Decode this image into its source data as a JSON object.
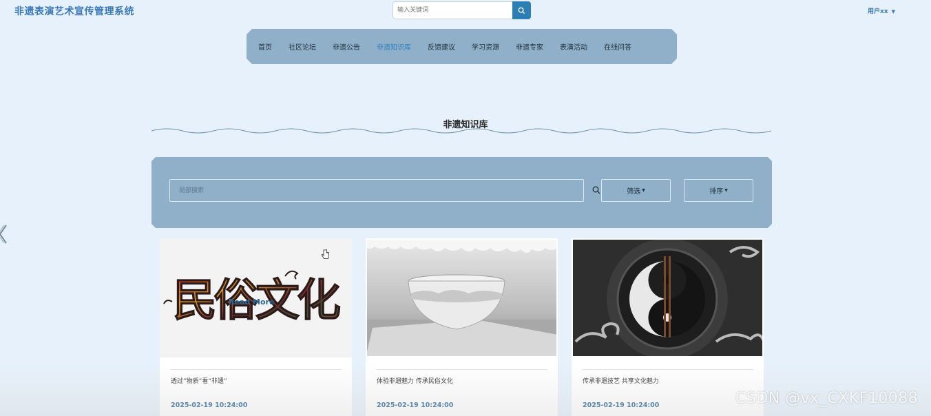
{
  "header": {
    "title": "非遗表演艺术宣传管理系统",
    "search_placeholder": "输入关键词",
    "user": "用户xx"
  },
  "nav": {
    "items": [
      {
        "label": "首页"
      },
      {
        "label": "社区论坛"
      },
      {
        "label": "非遗公告"
      },
      {
        "label": "非遗知识库"
      },
      {
        "label": "反馈建议"
      },
      {
        "label": "学习资源"
      },
      {
        "label": "非遗专家"
      },
      {
        "label": "表演活动"
      },
      {
        "label": "在线问答"
      }
    ],
    "active": "非遗知识库"
  },
  "section": {
    "title": "非遗知识库"
  },
  "filters": {
    "search_placeholder": "局部搜索",
    "filter_label": "筛选",
    "sort_label": "排序"
  },
  "cards": [
    {
      "title": "透过“物质”看“非遗”",
      "date": "2025-02-19 10:24:00",
      "overlay": "Read More",
      "image_text": "民俗文化"
    },
    {
      "title": "体验非遗魅力 传承民俗文化",
      "date": "2025-02-19 10:24:00"
    },
    {
      "title": "传承非遗技艺 共享文化魅力",
      "date": "2025-02-19 10:24:00"
    }
  ],
  "watermark": "CSDN @vx_CXKF10088",
  "colors": {
    "background": "#e7f1fb",
    "nav_bg": "#8fb0c8",
    "accent": "#2b7fb5",
    "date": "#2d6a9a"
  }
}
